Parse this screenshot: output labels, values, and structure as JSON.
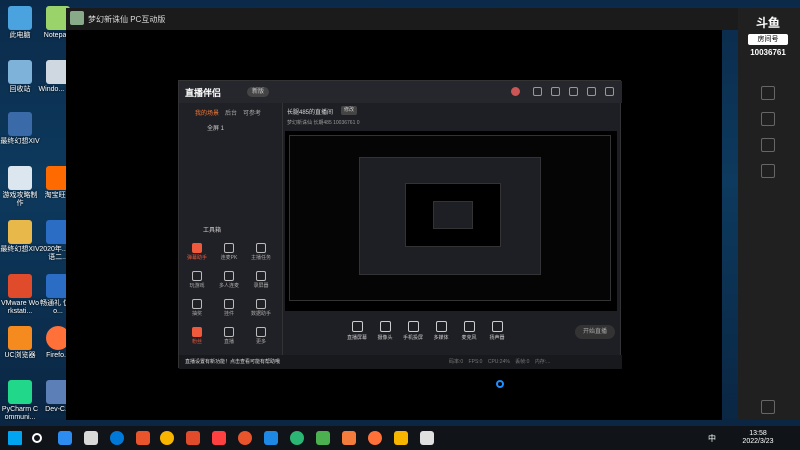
{
  "desktop": {
    "icons": [
      {
        "label": "此电脑",
        "color": "#4aa3df"
      },
      {
        "label": "Notepa...",
        "color": "#9ad36a"
      },
      {
        "label": "回收站",
        "color": "#7fb2d9"
      },
      {
        "label": "Windo... - 快",
        "color": "#cfd8e0"
      },
      {
        "label": "最终幻想XIV",
        "color": "#3a6aa8"
      },
      {
        "label": "游戏攻略制作",
        "color": "#dce6ef"
      },
      {
        "label": "淘宝旺...",
        "color": "#ff6a00"
      },
      {
        "label": "最终幻想XIV",
        "color": "#e8b84a"
      },
      {
        "label": "2020年... 英语二...",
        "color": "#2b6cc4"
      },
      {
        "label": "VMware Workstati...",
        "color": "#e04b2c"
      },
      {
        "label": "畅通礼 仿.do...",
        "color": "#2b6cc4"
      },
      {
        "label": "UC浏览器",
        "color": "#f58a1f"
      },
      {
        "label": "Firefo...",
        "color": "#ff7139"
      },
      {
        "label": "PyCharm Communi...",
        "color": "#21d789"
      },
      {
        "label": "Dev-C...",
        "color": "#5c7fb8"
      }
    ]
  },
  "pc_window": {
    "title": "梦幻新诛仙 PC互动版",
    "rail": {
      "brand": "斗鱼",
      "room_label": "房间号",
      "room_id": "10036761"
    }
  },
  "inner_app": {
    "logo": "直播伴侣",
    "version": "新版",
    "tabs": [
      "我的场景",
      "后台",
      "可参考"
    ],
    "scene": "全屏 1",
    "room_title": "长腿485的直播间",
    "room_btn": "修改",
    "room_meta": "梦幻新诛仙  长期485  10036761  0",
    "tools_header": "工具箱",
    "tools": [
      {
        "label": "弹幕助手",
        "hot": true
      },
      {
        "label": "连麦PK",
        "hot": false
      },
      {
        "label": "主播任务",
        "hot": false
      },
      {
        "label": "玩游戏",
        "hot": false
      },
      {
        "label": "多人连麦",
        "hot": false
      },
      {
        "label": "录屏器",
        "hot": false
      },
      {
        "label": "抽奖",
        "hot": false
      },
      {
        "label": "挂件",
        "hot": false
      },
      {
        "label": "数据助手",
        "hot": false
      },
      {
        "label": "粉丝",
        "hot": true
      },
      {
        "label": "直播",
        "hot": false
      },
      {
        "label": "更多",
        "hot": false
      }
    ],
    "bottom_tools": [
      "直播屏幕",
      "摄像头",
      "手机投屏",
      "多媒体",
      "麦克风",
      "扬声器"
    ],
    "go_live": "开始直播",
    "notice": "直播设置有新功能！点击查看可能有帮助哦",
    "stats": "码率:0  FPS:0  CPU:24%  丢帧:0  内存:..."
  },
  "taskbar": {
    "apps": [
      "#00a4ef",
      "#f1f1f1",
      "#d9d9d9",
      "#0078d7",
      "#e8542b",
      "#f7b500",
      "#e04b2c",
      "#ff4040",
      "#1e88e5",
      "#2bb673",
      "#f37b3c",
      "#ff7139",
      "#f7b500",
      "#e0e0e0"
    ],
    "language": "中",
    "time": "13:58",
    "date": "2022/3/23"
  }
}
